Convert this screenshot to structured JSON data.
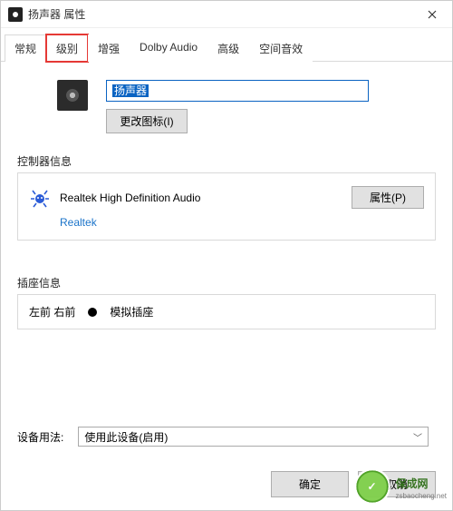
{
  "window": {
    "title": "扬声器 属性"
  },
  "tabs": [
    "常规",
    "级别",
    "增强",
    "Dolby Audio",
    "高级",
    "空间音效"
  ],
  "active_tab_index": 0,
  "highlighted_tab_index": 1,
  "device": {
    "name": "扬声器",
    "change_icon_btn": "更改图标(I)"
  },
  "controller": {
    "section_label": "控制器信息",
    "name": "Realtek High Definition Audio",
    "vendor": "Realtek",
    "attr_btn": "属性(P)"
  },
  "jack": {
    "section_label": "插座信息",
    "position": "左前 右前",
    "type": "模拟插座"
  },
  "usage": {
    "label": "设备用法:",
    "selected": "使用此设备(启用)"
  },
  "footer": {
    "ok": "确定",
    "cancel": "取消"
  },
  "watermark": {
    "brand": "保成网",
    "url": "zsbaocheng.net"
  }
}
